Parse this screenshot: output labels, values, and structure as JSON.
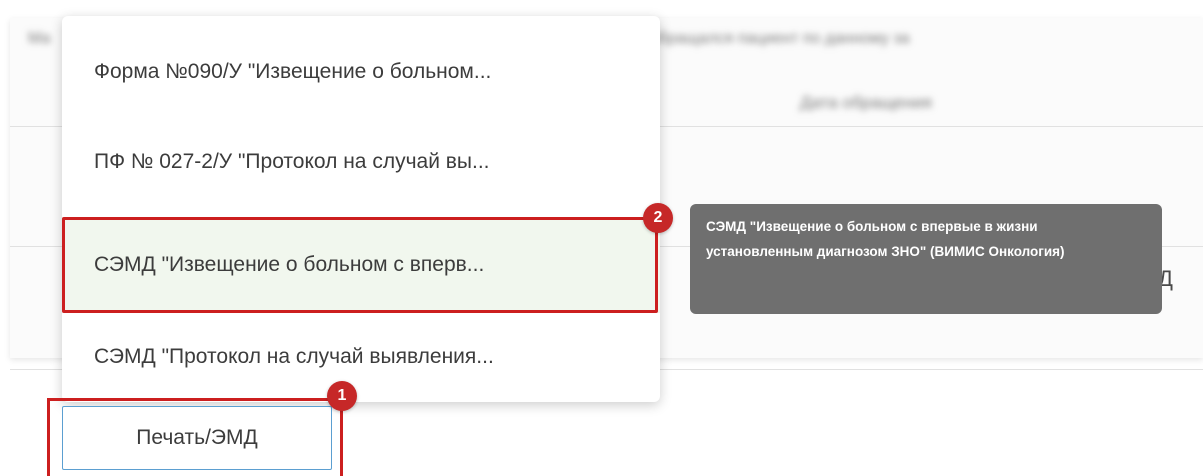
{
  "menu": {
    "items": [
      {
        "label": "Форма №090/У \"Извещение о больном..."
      },
      {
        "label": "ПФ № 027-2/У \"Протокол на случай вы..."
      },
      {
        "label": "СЭМД \"Извещение о больном с вперв..."
      },
      {
        "label": "СЭМД \"Протокол на случай выявления..."
      }
    ]
  },
  "tooltip": {
    "text": "СЭМД \"Извещение о больном с впервые в жизни установленным диагнозом ЗНО\" (ВИМИС Онкология)"
  },
  "badges": {
    "first": "1",
    "second": "2"
  },
  "print_button": {
    "label": "Печать/ЭМД"
  },
  "background": {
    "info_icon": "info-circle-icon",
    "edge_text": "Д"
  },
  "colors": {
    "highlight": "#cc1f1f",
    "badge": "#c62828",
    "tooltip_bg": "#6f6f6f",
    "selected_item_bg": "#f1f7ee",
    "button_border": "#5b9fd1"
  }
}
